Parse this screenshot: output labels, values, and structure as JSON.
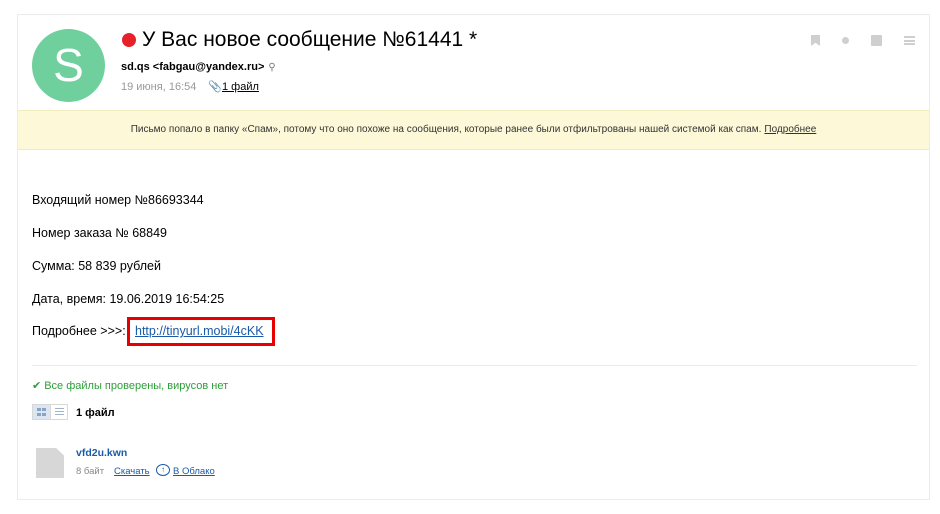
{
  "message": {
    "avatar_letter": "S",
    "subject": "У Вас новое сообщение №61441 *",
    "sender": "sd.qs <fabgau@yandex.ru>",
    "date": "19 июня, 16:54",
    "attachments_link": "1 файл"
  },
  "toolbar": {
    "icons": [
      "bookmark-icon",
      "dot-icon",
      "archive-icon",
      "menu-icon"
    ]
  },
  "spam_banner": {
    "text": "Письмо попало в папку «Спам», потому что оно похоже на сообщения, которые ранее были отфильтрованы нашей системой как спам.",
    "link": "Подробнее"
  },
  "body": {
    "line1": "Входящий номер №86693344",
    "line2": "Номер заказа № 68849",
    "line3": "Сумма: 58 839 рублей",
    "line4": "Дата, время: 19.06.2019 16:54:25",
    "line5_prefix": "Подробнее >>>:",
    "line5_link": "http://tinyurl.mobi/4cKK"
  },
  "attachments": {
    "virus_status": "Все файлы проверены, вирусов нет",
    "count_label": "1 файл",
    "files": [
      {
        "name": "vfd2u.kwn",
        "size": "8 байт",
        "download": "Скачать",
        "cloud": "В Облако"
      }
    ]
  },
  "colors": {
    "avatar": "#6fd09d",
    "unread": "#e6212a",
    "link": "#1a5aa8",
    "banner_bg": "#fcf8d8",
    "virus_ok": "#2e9e3a",
    "highlight": "#e60000"
  }
}
